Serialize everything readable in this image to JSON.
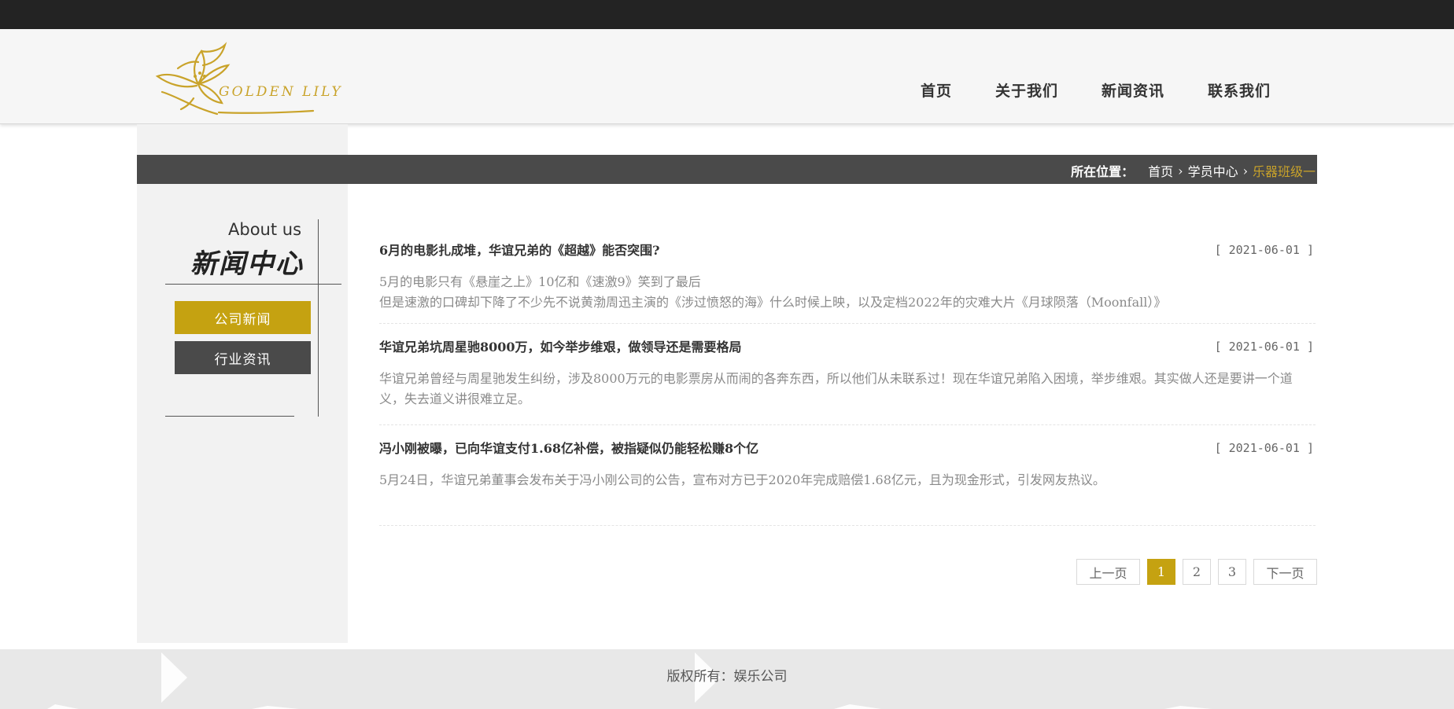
{
  "header": {
    "logo_text": "GOLDEN LILY",
    "nav": [
      "首页",
      "关于我们",
      "新闻资讯",
      "联系我们"
    ]
  },
  "breadcrumb": {
    "label": "所在位置：",
    "items": [
      "首页",
      "学员中心"
    ],
    "current": "乐器班级一"
  },
  "sidebar": {
    "title_en": "About us",
    "title_cn": "新闻中心",
    "buttons": [
      "公司新闻",
      "行业资讯"
    ],
    "active_index": 0
  },
  "news": [
    {
      "title": "6月的电影扎成堆，华谊兄弟的《超越》能否突围?",
      "date": "[ 2021-06-01 ]",
      "lines": [
        "5月的电影只有《悬崖之上》10亿和《速激9》笑到了最后",
        "但是速激的口碑却下降了不少先不说黄渤周迅主演的《涉过愤怒的海》什么时候上映，以及定档2022年的灾难大片《月球陨落（Moonfall）》"
      ]
    },
    {
      "title": "华谊兄弟坑周星驰8000万，如今举步维艰，做领导还是需要格局",
      "date": "[ 2021-06-01 ]",
      "lines": [
        "华谊兄弟曾经与周星驰发生纠纷，涉及8000万元的电影票房从而闹的各奔东西，所以他们从未联系过！现在华谊兄弟陷入困境，举步维艰。其实做人还是要讲一个道义，失去道义讲很难立足。"
      ]
    },
    {
      "title": "冯小刚被曝，已向华谊支付1.68亿补偿，被指疑似仍能轻松赚8个亿",
      "date": "[ 2021-06-01 ]",
      "lines": [
        "5月24日，华谊兄弟董事会发布关于冯小刚公司的公告，宣布对方已于2020年完成赔偿1.68亿元，且为现金形式，引发网友热议。"
      ]
    }
  ],
  "pagination": {
    "prev": "上一页",
    "pages": [
      "1",
      "2",
      "3"
    ],
    "active": "1",
    "next": "下一页"
  },
  "footer": {
    "copyright": "版权所有：娱乐公司"
  },
  "colors": {
    "accent": "#c5a211",
    "dark_bar": "#4a4a4a",
    "top_bar": "#232323"
  }
}
